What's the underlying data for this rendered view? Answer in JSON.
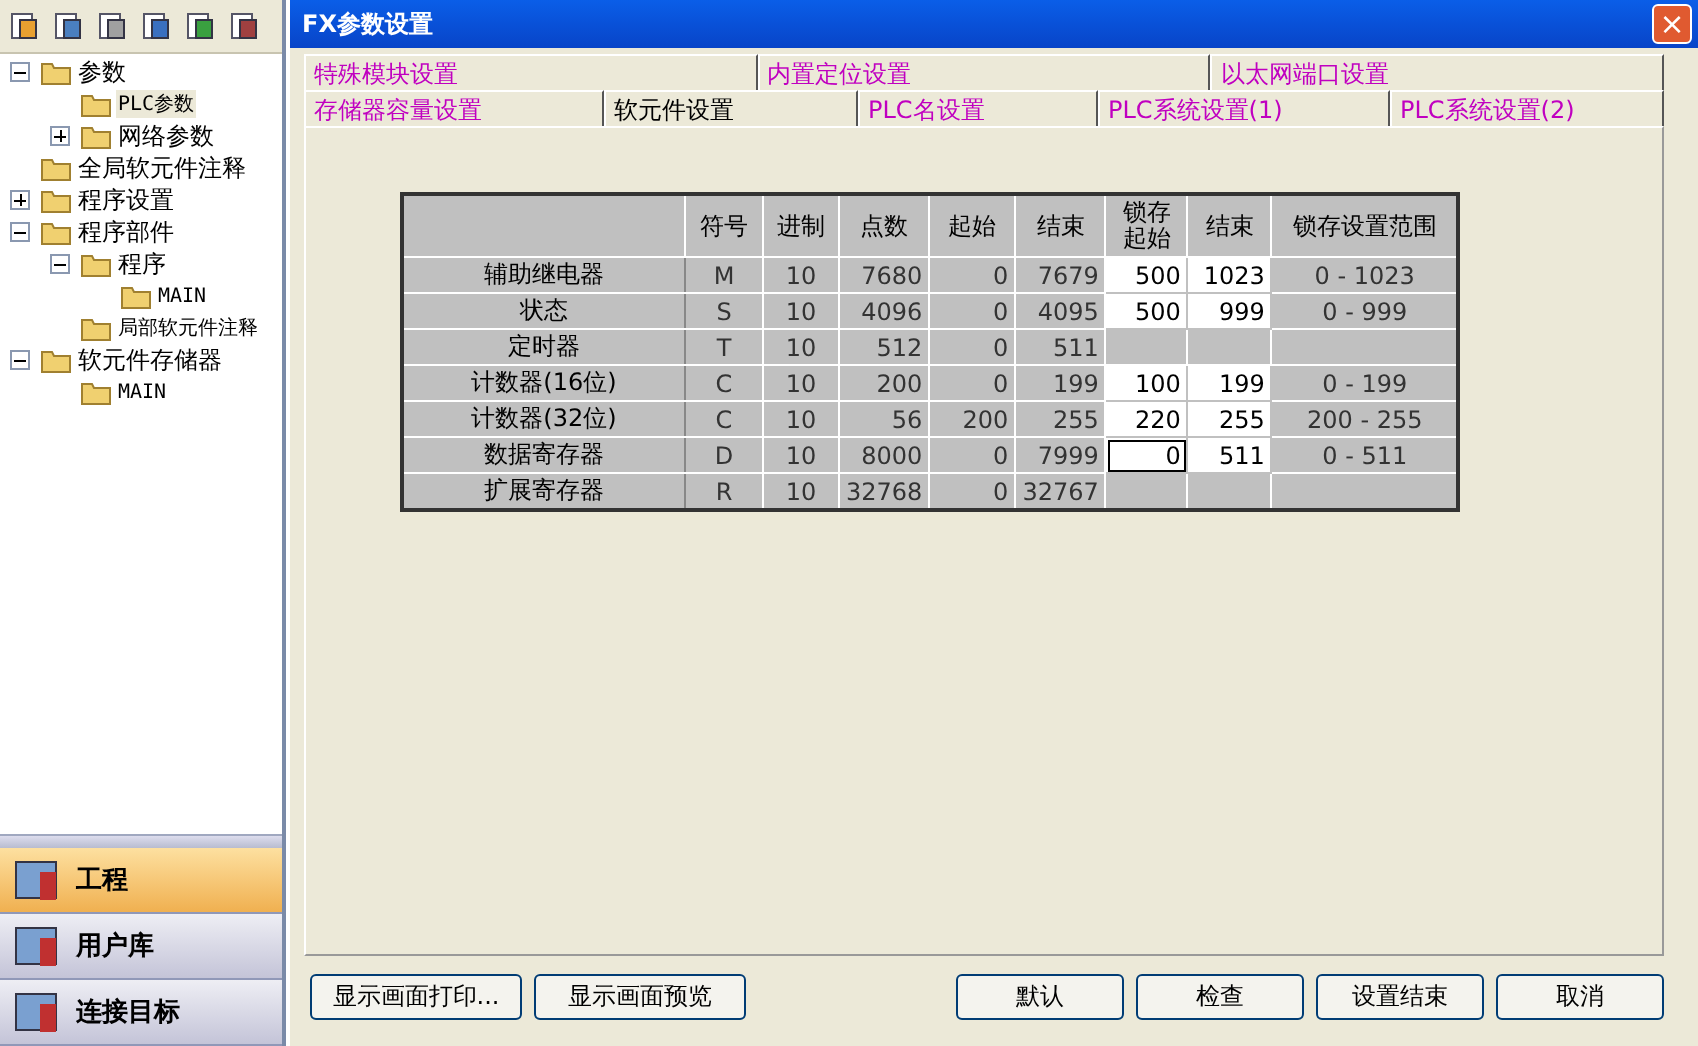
{
  "tree": [
    {
      "label": "参数",
      "kind": "branch",
      "expanded": true,
      "selected": false,
      "children": [
        {
          "label": "PLC参数",
          "kind": "leaf",
          "selected": true
        },
        {
          "label": "网络参数",
          "kind": "branch",
          "expanded": false,
          "selected": false
        }
      ]
    },
    {
      "label": "全局软元件注释",
      "kind": "leaf",
      "selected": false
    },
    {
      "label": "程序设置",
      "kind": "branch",
      "expanded": false,
      "selected": false
    },
    {
      "label": "程序部件",
      "kind": "branch",
      "expanded": true,
      "selected": false,
      "children": [
        {
          "label": "程序",
          "kind": "branch",
          "expanded": true,
          "selected": false,
          "children": [
            {
              "label": "MAIN",
              "kind": "leaf",
              "selected": false
            }
          ]
        },
        {
          "label": "局部软元件注释",
          "kind": "leaf",
          "selected": false
        }
      ]
    },
    {
      "label": "软元件存储器",
      "kind": "branch",
      "expanded": true,
      "selected": false,
      "children": [
        {
          "label": "MAIN",
          "kind": "leaf",
          "selected": false
        }
      ]
    }
  ],
  "nav": [
    {
      "label": "工程",
      "selected": true
    },
    {
      "label": "用户库",
      "selected": false
    },
    {
      "label": "连接目标",
      "selected": false
    }
  ],
  "dialog": {
    "title": "FX参数设置",
    "close": "×",
    "tab_rows": [
      [
        {
          "label": "特殊模块设置",
          "selected": false
        },
        {
          "label": "内置定位设置",
          "selected": false
        },
        {
          "label": "以太网端口设置",
          "selected": false
        }
      ],
      [
        {
          "label": "存储器容量设置",
          "selected": false
        },
        {
          "label": "软元件设置",
          "selected": true
        },
        {
          "label": "PLC名设置",
          "selected": false
        },
        {
          "label": "PLC系统设置(1)",
          "selected": false
        },
        {
          "label": "PLC系统设置(2)",
          "selected": false
        }
      ]
    ],
    "table": {
      "columns": [
        "符号",
        "进制",
        "点数",
        "起始",
        "结束",
        "锁存起始",
        "结束",
        "锁存设置范围"
      ],
      "rows": [
        {
          "name": "辅助继电器",
          "symbol": "M",
          "radix": "10",
          "points": "7680",
          "start": "0",
          "end": "7679",
          "latch": {
            "editable": true,
            "start": "500",
            "end": "1023",
            "range": "0 - 1023",
            "focused": false
          }
        },
        {
          "name": "状态",
          "symbol": "S",
          "radix": "10",
          "points": "4096",
          "start": "0",
          "end": "4095",
          "latch": {
            "editable": true,
            "start": "500",
            "end": "999",
            "range": "0 - 999",
            "focused": false
          }
        },
        {
          "name": "定时器",
          "symbol": "T",
          "radix": "10",
          "points": "512",
          "start": "0",
          "end": "511",
          "latch": {
            "editable": false,
            "focused": false
          }
        },
        {
          "name": "计数器(16位)",
          "symbol": "C",
          "radix": "10",
          "points": "200",
          "start": "0",
          "end": "199",
          "latch": {
            "editable": true,
            "start": "100",
            "end": "199",
            "range": "0 - 199",
            "focused": false
          }
        },
        {
          "name": "计数器(32位)",
          "symbol": "C",
          "radix": "10",
          "points": "56",
          "start": "200",
          "end": "255",
          "latch": {
            "editable": true,
            "start": "220",
            "end": "255",
            "range": "200 - 255",
            "focused": false
          }
        },
        {
          "name": "数据寄存器",
          "symbol": "D",
          "radix": "10",
          "points": "8000",
          "start": "0",
          "end": "7999",
          "latch": {
            "editable": true,
            "start": "0",
            "end": "511",
            "range": "0 - 511",
            "focused": true
          }
        },
        {
          "name": "扩展寄存器",
          "symbol": "R",
          "radix": "10",
          "points": "32768",
          "start": "0",
          "end": "32767",
          "latch": {
            "editable": false,
            "focused": false
          }
        }
      ]
    },
    "left_buttons": [
      "显示画面打印...",
      "显示画面预览"
    ],
    "right_buttons": [
      "默认",
      "检查",
      "设置结束",
      "取消"
    ]
  }
}
